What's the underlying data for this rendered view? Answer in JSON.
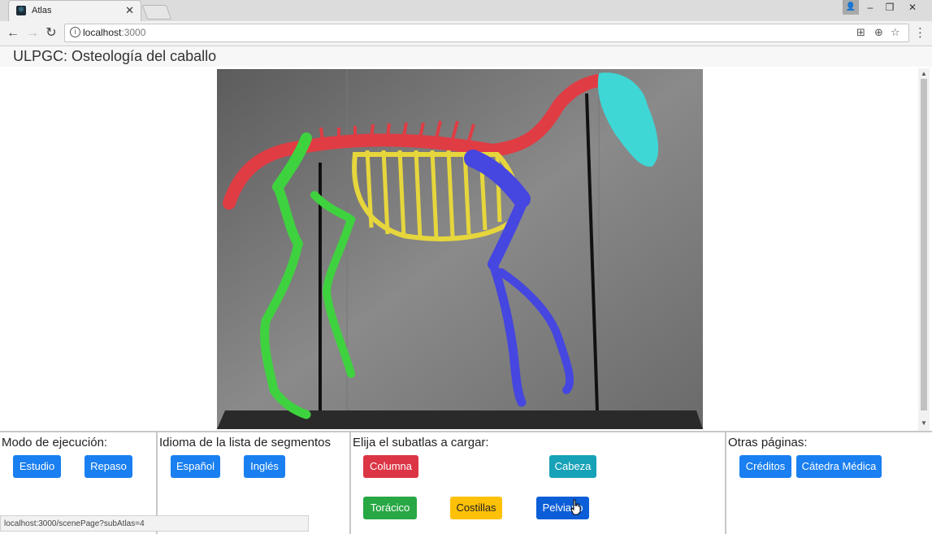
{
  "browser": {
    "tab_title": "Atlas",
    "tab_close": "✕",
    "url_host": "localhost",
    "url_port": ":3000",
    "status_url": "localhost:3000/scenePage?subAtlas=4"
  },
  "page": {
    "title": "ULPGC: Osteología del caballo"
  },
  "skeleton": {
    "segments": [
      "Columna",
      "Cabeza",
      "Torácico",
      "Costillas",
      "Pelviano"
    ],
    "colors": {
      "columna": "#e03c44",
      "cabeza": "#3fd6d6",
      "toracico": "#3fd23f",
      "costillas": "#e6d63c",
      "pelviano": "#4646e0",
      "background": "#6e6e6e"
    }
  },
  "panels": {
    "mode": {
      "title": "Modo de ejecución:",
      "buttons": [
        "Estudio",
        "Repaso"
      ]
    },
    "language": {
      "title": "Idioma de la lista de segmentos",
      "buttons": [
        "Español",
        "Inglés"
      ]
    },
    "subatlas": {
      "title": "Elija el subatlas a cargar:",
      "buttons": [
        "Columna",
        "Cabeza",
        "Torácico",
        "Costillas",
        "Pelviano"
      ]
    },
    "other": {
      "title": "Otras páginas:",
      "buttons": [
        "Créditos",
        "Cátedra Médica"
      ]
    }
  }
}
